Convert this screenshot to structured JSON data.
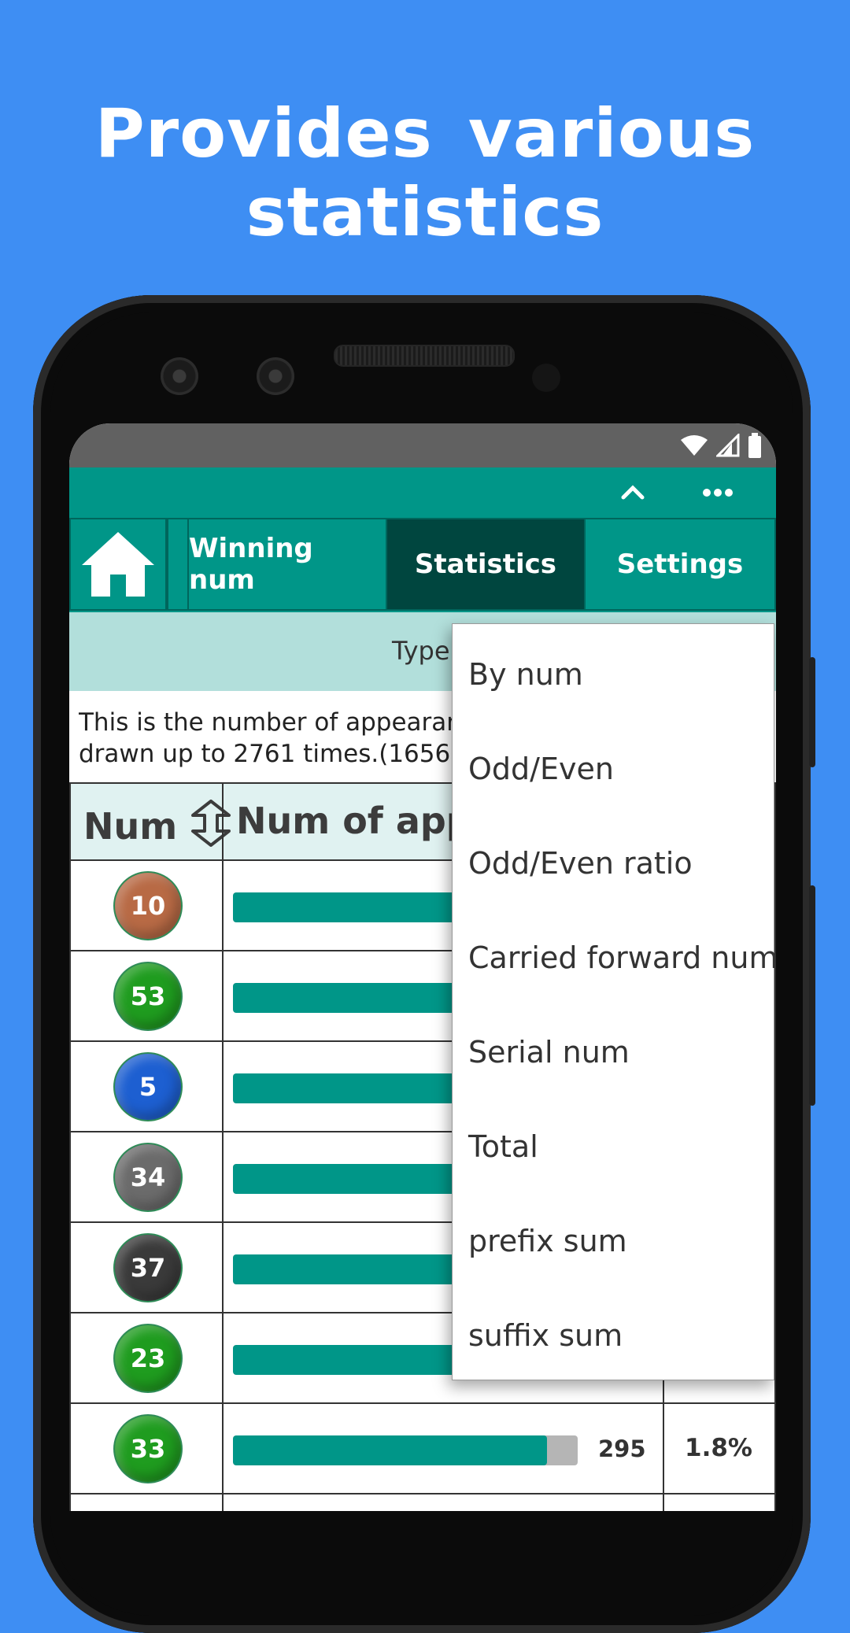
{
  "headline": "Provides various statistics",
  "tabs": {
    "home_icon": "home-icon",
    "winning": "Winning num",
    "statistics": "Statistics",
    "settings": "Settings"
  },
  "type_label": "Type",
  "description": {
    "line1": "This is the number of appearan",
    "line2": "drawn up to 2761 times.(1656"
  },
  "table": {
    "col_num": "Num",
    "col_count": "Num of appe",
    "rows": [
      {
        "ball": "10",
        "color": "#b86a45",
        "fill": 0.92
      },
      {
        "ball": "53",
        "color": "#1f9c1f",
        "fill": 0.92
      },
      {
        "ball": "5",
        "color": "#1d5fd1",
        "fill": 0.92
      },
      {
        "ball": "34",
        "color": "#6b6b6b",
        "fill": 0.92
      },
      {
        "ball": "37",
        "color": "#3a3a3a",
        "fill": 0.92
      },
      {
        "ball": "23",
        "color": "#1f9c1f",
        "fill": 0.92
      },
      {
        "ball": "33",
        "color": "#1f9c1f",
        "fill": 0.91,
        "count": "295",
        "pct": "1.8%"
      }
    ]
  },
  "menu": {
    "items": [
      "By num",
      "Odd/Even",
      "Odd/Even ratio",
      "Carried forward num",
      "Serial num",
      "Total",
      "prefix sum",
      "suffix sum"
    ]
  },
  "colors": {
    "background": "#3e8ef3",
    "primary": "#009688",
    "active_tab": "#00463f",
    "type_bar": "#b2dfdb"
  }
}
